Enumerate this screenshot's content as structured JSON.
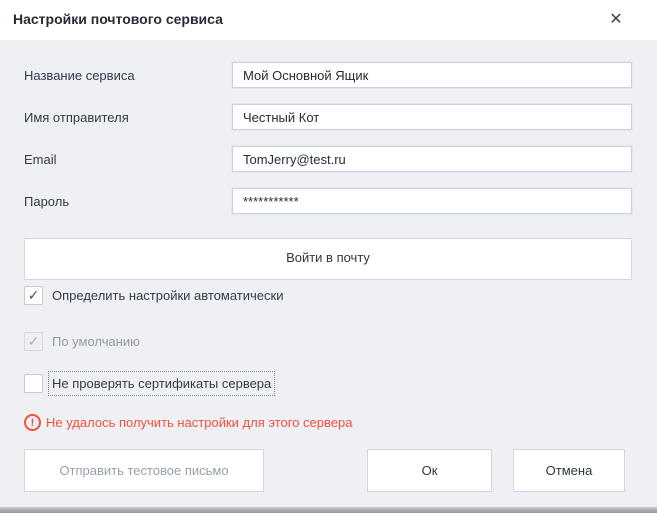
{
  "dialog": {
    "title": "Настройки почтового сервиса",
    "close_glyph": "✕"
  },
  "fields": [
    {
      "label": "Название сервиса",
      "value": "Мой Основной Ящик"
    },
    {
      "label": "Имя отправителя",
      "value": "Честный Кот"
    },
    {
      "label": "Email",
      "value": "TomJerry@test.ru"
    },
    {
      "label": "Пароль",
      "value": "***********"
    }
  ],
  "login_button_label": "Войти в почту",
  "checkboxes": [
    {
      "label": "Определить настройки автоматически",
      "checked": true,
      "disabled": false,
      "glyph": "✓"
    },
    {
      "label": "По умолчанию",
      "checked": true,
      "disabled": true,
      "glyph": "✓"
    },
    {
      "label": "Не проверять сертификаты сервера",
      "checked": false,
      "disabled": false,
      "glyph": ""
    }
  ],
  "error": {
    "icon_glyph": "!",
    "message": "Не удалось получить настройки для этого сервера",
    "color": "#f4503c"
  },
  "footer": {
    "send_test_label": "Отправить тестовое письмо",
    "ok_label": "Ок",
    "cancel_label": "Отмена"
  },
  "colors": {
    "body_bg": "#eef0f4",
    "header_bg": "#ffffff",
    "error": "#f4503c"
  }
}
